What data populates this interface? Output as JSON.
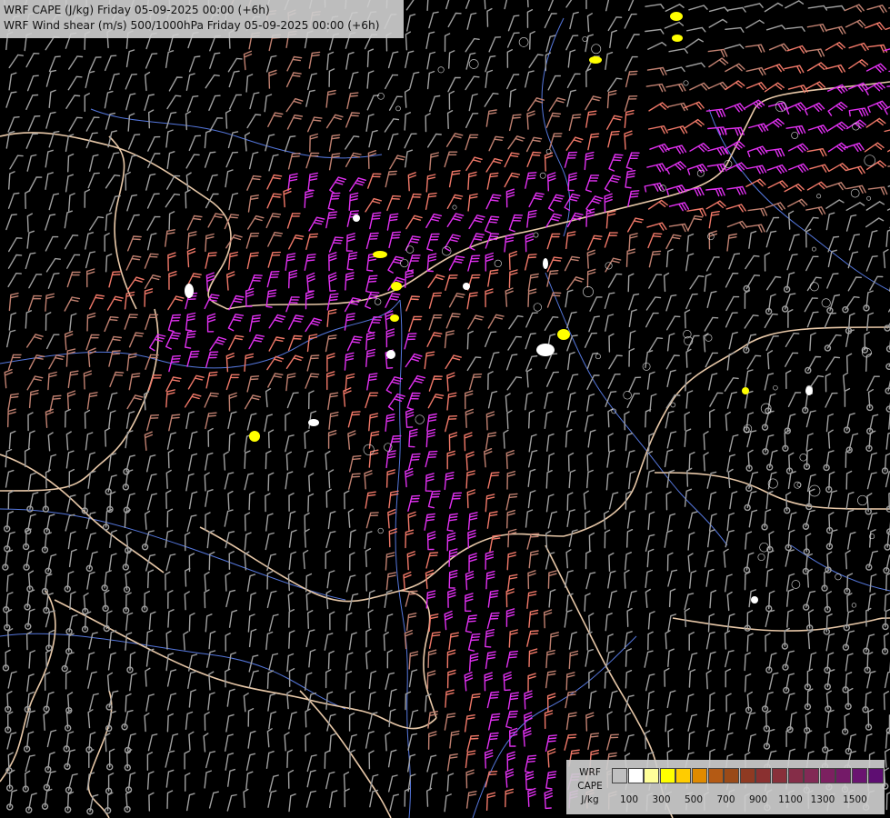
{
  "header": {
    "line1": "WRF CAPE (J/kg) Friday 05-09-2025 00:00 (+6h)",
    "line2": "WRF Wind shear (m/s) 500/1000hPa Friday 05-09-2025 00:00 (+6h)"
  },
  "legend": {
    "label_model": "WRF",
    "label_field": "CAPE",
    "label_unit": "J/kg",
    "colors": [
      "#c0c0c0",
      "#ffffff",
      "#ffff99",
      "#ffff00",
      "#ffcc00",
      "#e08a00",
      "#b45a14",
      "#9a4a18",
      "#8f3a22",
      "#8a3030",
      "#88303a",
      "#852d48",
      "#822a55",
      "#7c2060",
      "#741a68",
      "#6a1470",
      "#5e0e72"
    ],
    "ticks": [
      "100",
      "300",
      "500",
      "700",
      "900",
      "1100",
      "1300",
      "1500"
    ]
  },
  "map_colors": {
    "background": "#000000",
    "border": "#e8c8a8",
    "river": "#5577dd",
    "barb_weak": "#a0a0a0",
    "barb_moderate": "#c08070",
    "barb_salmon": "#f07868",
    "barb_strong": "#e030f0",
    "cape_yellow": "#ffff00",
    "cape_white": "#ffffff"
  }
}
